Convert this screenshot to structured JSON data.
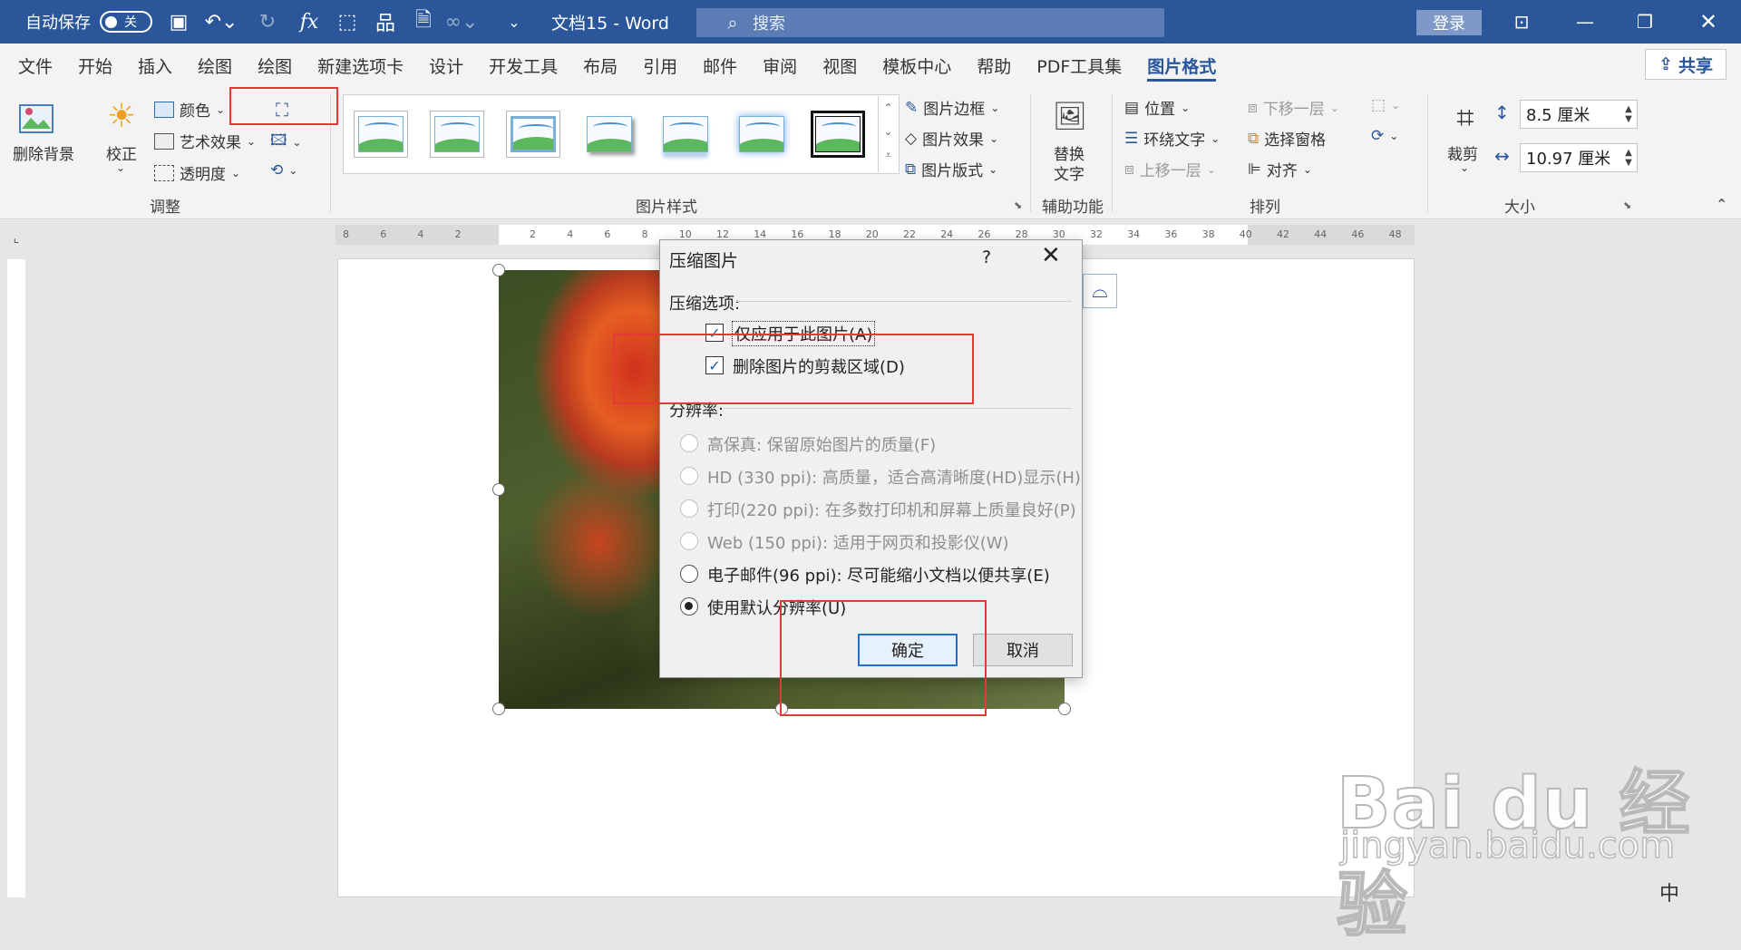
{
  "titlebar": {
    "autosave_label": "自动保存",
    "autosave_state": "关",
    "doc_title": "文档15  -  Word",
    "search_placeholder": "搜索",
    "login": "登录",
    "color": "#2b579a"
  },
  "tabs": [
    "文件",
    "开始",
    "插入",
    "绘图",
    "绘图",
    "新建选项卡",
    "设计",
    "开发工具",
    "布局",
    "引用",
    "邮件",
    "审阅",
    "视图",
    "模板中心",
    "帮助",
    "PDF工具集",
    "图片格式"
  ],
  "active_tab": "图片格式",
  "share": "共享",
  "ribbon": {
    "remove_bg": "删除背景",
    "correct": "校正",
    "color": "颜色",
    "art_effect": "艺术效果",
    "transparency": "透明度",
    "group_adjust": "调整",
    "group_styles": "图片样式",
    "border": "图片边框",
    "effect": "图片效果",
    "layout": "图片版式",
    "alt_text_1": "替换",
    "alt_text_2": "文字",
    "group_aux": "辅助功能",
    "position": "位置",
    "wrap_text": "环绕文字",
    "bring_forward": "上移一层",
    "send_backward": "下移一层",
    "selection_pane": "选择窗格",
    "align": "对齐",
    "group_arrange": "排列",
    "crop": "裁剪",
    "height": "8.5 厘米",
    "width": "10.97 厘米",
    "group_size": "大小"
  },
  "ruler_labels": [
    "8",
    "6",
    "4",
    "2",
    "",
    "2",
    "4",
    "6",
    "8",
    "10",
    "12",
    "14",
    "16",
    "18",
    "20",
    "22",
    "24",
    "26",
    "28",
    "30",
    "32",
    "34",
    "36",
    "38",
    "40",
    "42",
    "44",
    "46",
    "48"
  ],
  "dialog": {
    "title": "压缩图片",
    "help": "?",
    "section_compress": "压缩选项:",
    "apply_only": "仅应用于此图片(A)",
    "delete_crop": "删除图片的剪裁区域(D)",
    "section_resolution": "分辨率:",
    "options": [
      {
        "label": "高保真: 保留原始图片的质量(F)",
        "enabled": false,
        "selected": false
      },
      {
        "label": "HD (330 ppi): 高质量，适合高清晰度(HD)显示(H)",
        "enabled": false,
        "selected": false
      },
      {
        "label": "打印(220 ppi): 在多数打印机和屏幕上质量良好(P)",
        "enabled": false,
        "selected": false
      },
      {
        "label": "Web (150 ppi): 适用于网页和投影仪(W)",
        "enabled": false,
        "selected": false
      },
      {
        "label": "电子邮件(96 ppi): 尽可能缩小文档以便共享(E)",
        "enabled": true,
        "selected": false
      },
      {
        "label": "使用默认分辨率(U)",
        "enabled": true,
        "selected": true
      }
    ],
    "ok": "确定",
    "cancel": "取消"
  },
  "watermark": {
    "logo": "Bai du 经验",
    "url": "jingyan.baidu.com"
  },
  "status": "中"
}
